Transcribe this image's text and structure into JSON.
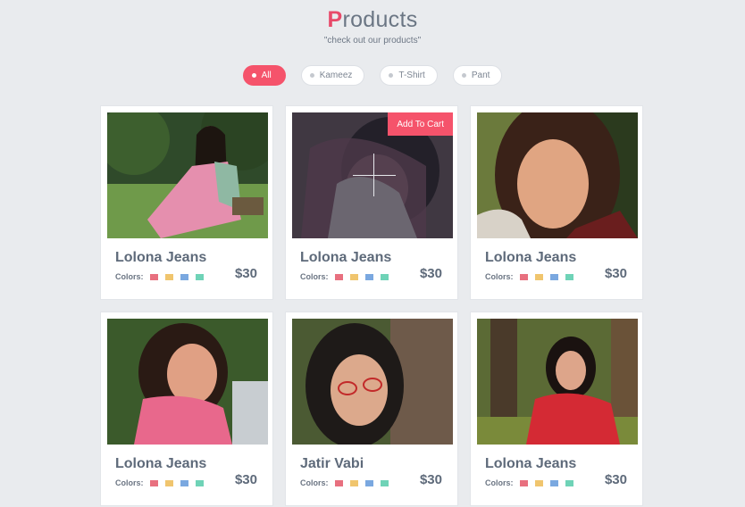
{
  "header": {
    "title_first": "P",
    "title_rest": "roducts",
    "subtitle": "\"check out our products\""
  },
  "filters": [
    {
      "label": "All",
      "active": true
    },
    {
      "label": "Kameez",
      "active": false
    },
    {
      "label": "T-Shirt",
      "active": false
    },
    {
      "label": "Pant",
      "active": false
    }
  ],
  "cart_label": "Add To Cart",
  "colors_label": "Colors:",
  "swatch_colors": [
    "#e8707f",
    "#f0c56e",
    "#7aa8e0",
    "#6fd3b7"
  ],
  "products": [
    {
      "name": "Lolona Jeans",
      "price": "$30"
    },
    {
      "name": "Lolona Jeans",
      "price": "$30"
    },
    {
      "name": "Lolona Jeans",
      "price": "$30"
    },
    {
      "name": "Lolona Jeans",
      "price": "$30"
    },
    {
      "name": "Jatir Vabi",
      "price": "$30"
    },
    {
      "name": "Lolona Jeans",
      "price": "$30"
    }
  ]
}
